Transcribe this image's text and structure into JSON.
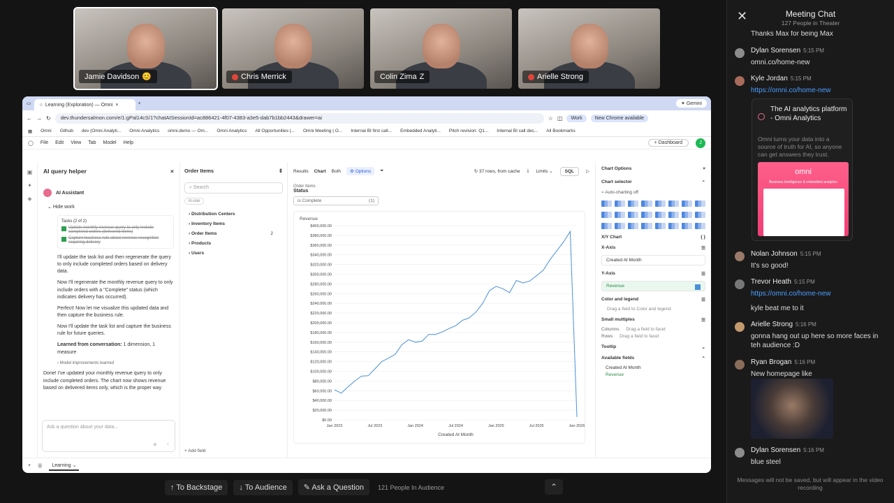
{
  "participants": [
    {
      "name": "Jamie Davidson",
      "badge": "😊",
      "muted": false,
      "active": true
    },
    {
      "name": "Chris Merrick",
      "badge": "",
      "muted": true,
      "active": false
    },
    {
      "name": "Colin Zima",
      "badge": "Z",
      "muted": false,
      "active": false
    },
    {
      "name": "Arielle Strong",
      "badge": "",
      "muted": true,
      "active": false
    }
  ],
  "browser": {
    "tab_title": "Learning (Exploration) — Omni",
    "gemini": "Gemini",
    "url": "dev.thundersalmon.com/e/1:gPal14cS/1?chatAISessionId=ac886421-4f07-4383-a3e5-dab7b1bb2443&drawer=ai",
    "work": "Work",
    "new_chrome": "New Chrome available",
    "bookmarks": [
      "Omni",
      "Github",
      "dev (Omni Analyti...",
      "Omni Analytics",
      "omni.demo — Om...",
      "Omni Analytics",
      "All Opportunities |...",
      "Omni Meeting | O...",
      "Internal BI first call...",
      "Embedded Analyti...",
      "Pitch revision: Q1...",
      "Internal BI call dec..."
    ],
    "all_bookmarks": "All Bookmarks",
    "menu": [
      "File",
      "Edit",
      "View",
      "Tab",
      "Model",
      "Help"
    ],
    "dashboard": "Dashboard",
    "avatar": "J"
  },
  "ai_panel": {
    "title": "AI query helper",
    "assistant": "AI Assistant",
    "hide_work": "Hide work",
    "tasks_header": "Tasks (2 of 2)",
    "tasks": [
      "Update monthly revenue query to only include completed orders (delivered items)",
      "Capture business rule about revenue recognition requiring delivery"
    ],
    "paragraphs": [
      "I'll update the task list and then regenerate the query to only include completed orders based on delivery data.",
      "Now I'll regenerate the monthly revenue query to only include orders with a \"Complete\" status (which indicates delivery has occurred).",
      "Perfect! Now let me visualize this updated data and then capture the business rule.",
      "Now I'll update the task list and capture the business rule for future queries."
    ],
    "learned_label": "Learned from conversation:",
    "learned_value": "1 dimension, 1 measure",
    "model_improvements": "Model improvements learned",
    "done": "Done! I've updated your monthly revenue query to only include completed orders. The chart now shows revenue based on delivered items only, which is the proper way",
    "placeholder": "Ask a question about your data..."
  },
  "tree": {
    "title": "Order Items",
    "search": "Search",
    "chip": "in-use",
    "items": [
      "Distribution Centers",
      "Inventory Items",
      "Order Items",
      "Products",
      "Users"
    ],
    "order_items_count": "2",
    "add_field": "Add field"
  },
  "toolbar": {
    "results": "Results",
    "chart": "Chart",
    "both": "Both",
    "options": "Options",
    "rows": "37 rows, from cache",
    "limits": "Limits",
    "sql": "SQL"
  },
  "filter": {
    "view": "Order Items",
    "field": "Status",
    "value": "is Complete",
    "count": "(1)"
  },
  "chart_data": {
    "type": "line",
    "title": "",
    "series_label": "Revenue",
    "xlabel": "Created At Month",
    "ylabel": "",
    "ylim": [
      0,
      400000
    ],
    "yticks": [
      "$0.00",
      "$20,000.00",
      "$40,000.00",
      "$60,000.00",
      "$80,000.00",
      "$100,000.00",
      "$120,000.00",
      "$140,000.00",
      "$160,000.00",
      "$180,000.00",
      "$200,000.00",
      "$220,000.00",
      "$240,000.00",
      "$260,000.00",
      "$280,000.00",
      "$300,000.00",
      "$320,000.00",
      "$340,000.00",
      "$360,000.00",
      "$380,000.00",
      "$400,000.00"
    ],
    "xticks": [
      "Jan 2023",
      "Jul 2023",
      "Jan 2024",
      "Jul 2024",
      "Jan 2025",
      "Jul 2025",
      "Jan 2026"
    ],
    "x": [
      "2023-01",
      "2023-02",
      "2023-03",
      "2023-04",
      "2023-05",
      "2023-06",
      "2023-07",
      "2023-08",
      "2023-09",
      "2023-10",
      "2023-11",
      "2023-12",
      "2024-01",
      "2024-02",
      "2024-03",
      "2024-04",
      "2024-05",
      "2024-06",
      "2024-07",
      "2024-08",
      "2024-09",
      "2024-10",
      "2024-11",
      "2024-12",
      "2025-01",
      "2025-02",
      "2025-03",
      "2025-04",
      "2025-05",
      "2025-06",
      "2025-07",
      "2025-08",
      "2025-09",
      "2025-10",
      "2025-11",
      "2025-12",
      "2026-01"
    ],
    "values": [
      62000,
      55000,
      68000,
      80000,
      90000,
      91000,
      105000,
      120000,
      127000,
      135000,
      155000,
      165000,
      160000,
      162000,
      176000,
      176000,
      181000,
      188000,
      194000,
      205000,
      210000,
      222000,
      240000,
      266000,
      275000,
      270000,
      262000,
      287000,
      282000,
      286000,
      297000,
      308000,
      330000,
      348000,
      366000,
      388000,
      6000
    ],
    "grid": true,
    "line_color": "#4a90d9"
  },
  "options": {
    "title": "Chart Options",
    "chart_selector": "Chart selector",
    "autochart": "Auto-charting off",
    "xy": "X/Y Chart",
    "xaxis": "X-Axis",
    "xfield": "Created At Month",
    "yaxis": "Y-Axis",
    "yfield": "Revenue",
    "color": "Color and legend",
    "color_drop": "Drag a field to Color and legend",
    "small": "Small multiples",
    "columns": "Columns",
    "rows": "Rows",
    "facet": "Drag a field to facet",
    "tooltip": "Tooltip",
    "available": "Available fields",
    "af1": "Created At Month",
    "af2": "Revenue"
  },
  "statusbar": {
    "tab": "Learning"
  },
  "controls": {
    "backstage": "To Backstage",
    "audience": "To Audience",
    "ask": "Ask a Question",
    "count": "121 People In Audience"
  },
  "chat": {
    "title": "Meeting Chat",
    "subtitle": "127 People in Theater",
    "partial": "Thanks Max for being Max",
    "messages": [
      {
        "name": "Dylan Sorensen",
        "time": "5:15 PM",
        "text": "omni.co/home-new",
        "link": false
      },
      {
        "name": "Kyle Jordan",
        "time": "5:15 PM",
        "text": "https://omni.co/home-new",
        "link": true
      },
      {
        "name": "Nolan Johnson",
        "time": "5:15 PM",
        "text": "It's so good!",
        "link": false
      },
      {
        "name": "Trevor Heath",
        "time": "5:15 PM",
        "text": "https://omni.co/home-new",
        "link": true
      },
      {
        "name": "Arielle Strong",
        "time": "5:16 PM",
        "text": "gonna hang out up here so more faces in teh audience :D",
        "link": false
      },
      {
        "name": "Ryan Brogan",
        "time": "5:16 PM",
        "text": "New homepage like",
        "link": false
      },
      {
        "name": "Dylan Sorensen",
        "time": "5:16 PM",
        "text": "blue steel",
        "link": false
      }
    ],
    "trevor_extra": "kyle beat me to it",
    "card_title": "The AI analytics platform - Omni Analytics",
    "card_desc": "Omni turns your data into a source of truth for AI, so anyone can get answers they trust.",
    "card_logo": "omni",
    "card_tagline": "Business Intelligence & embedded analytics",
    "footer": "Messages will not be saved, but will appear in the video recording"
  }
}
